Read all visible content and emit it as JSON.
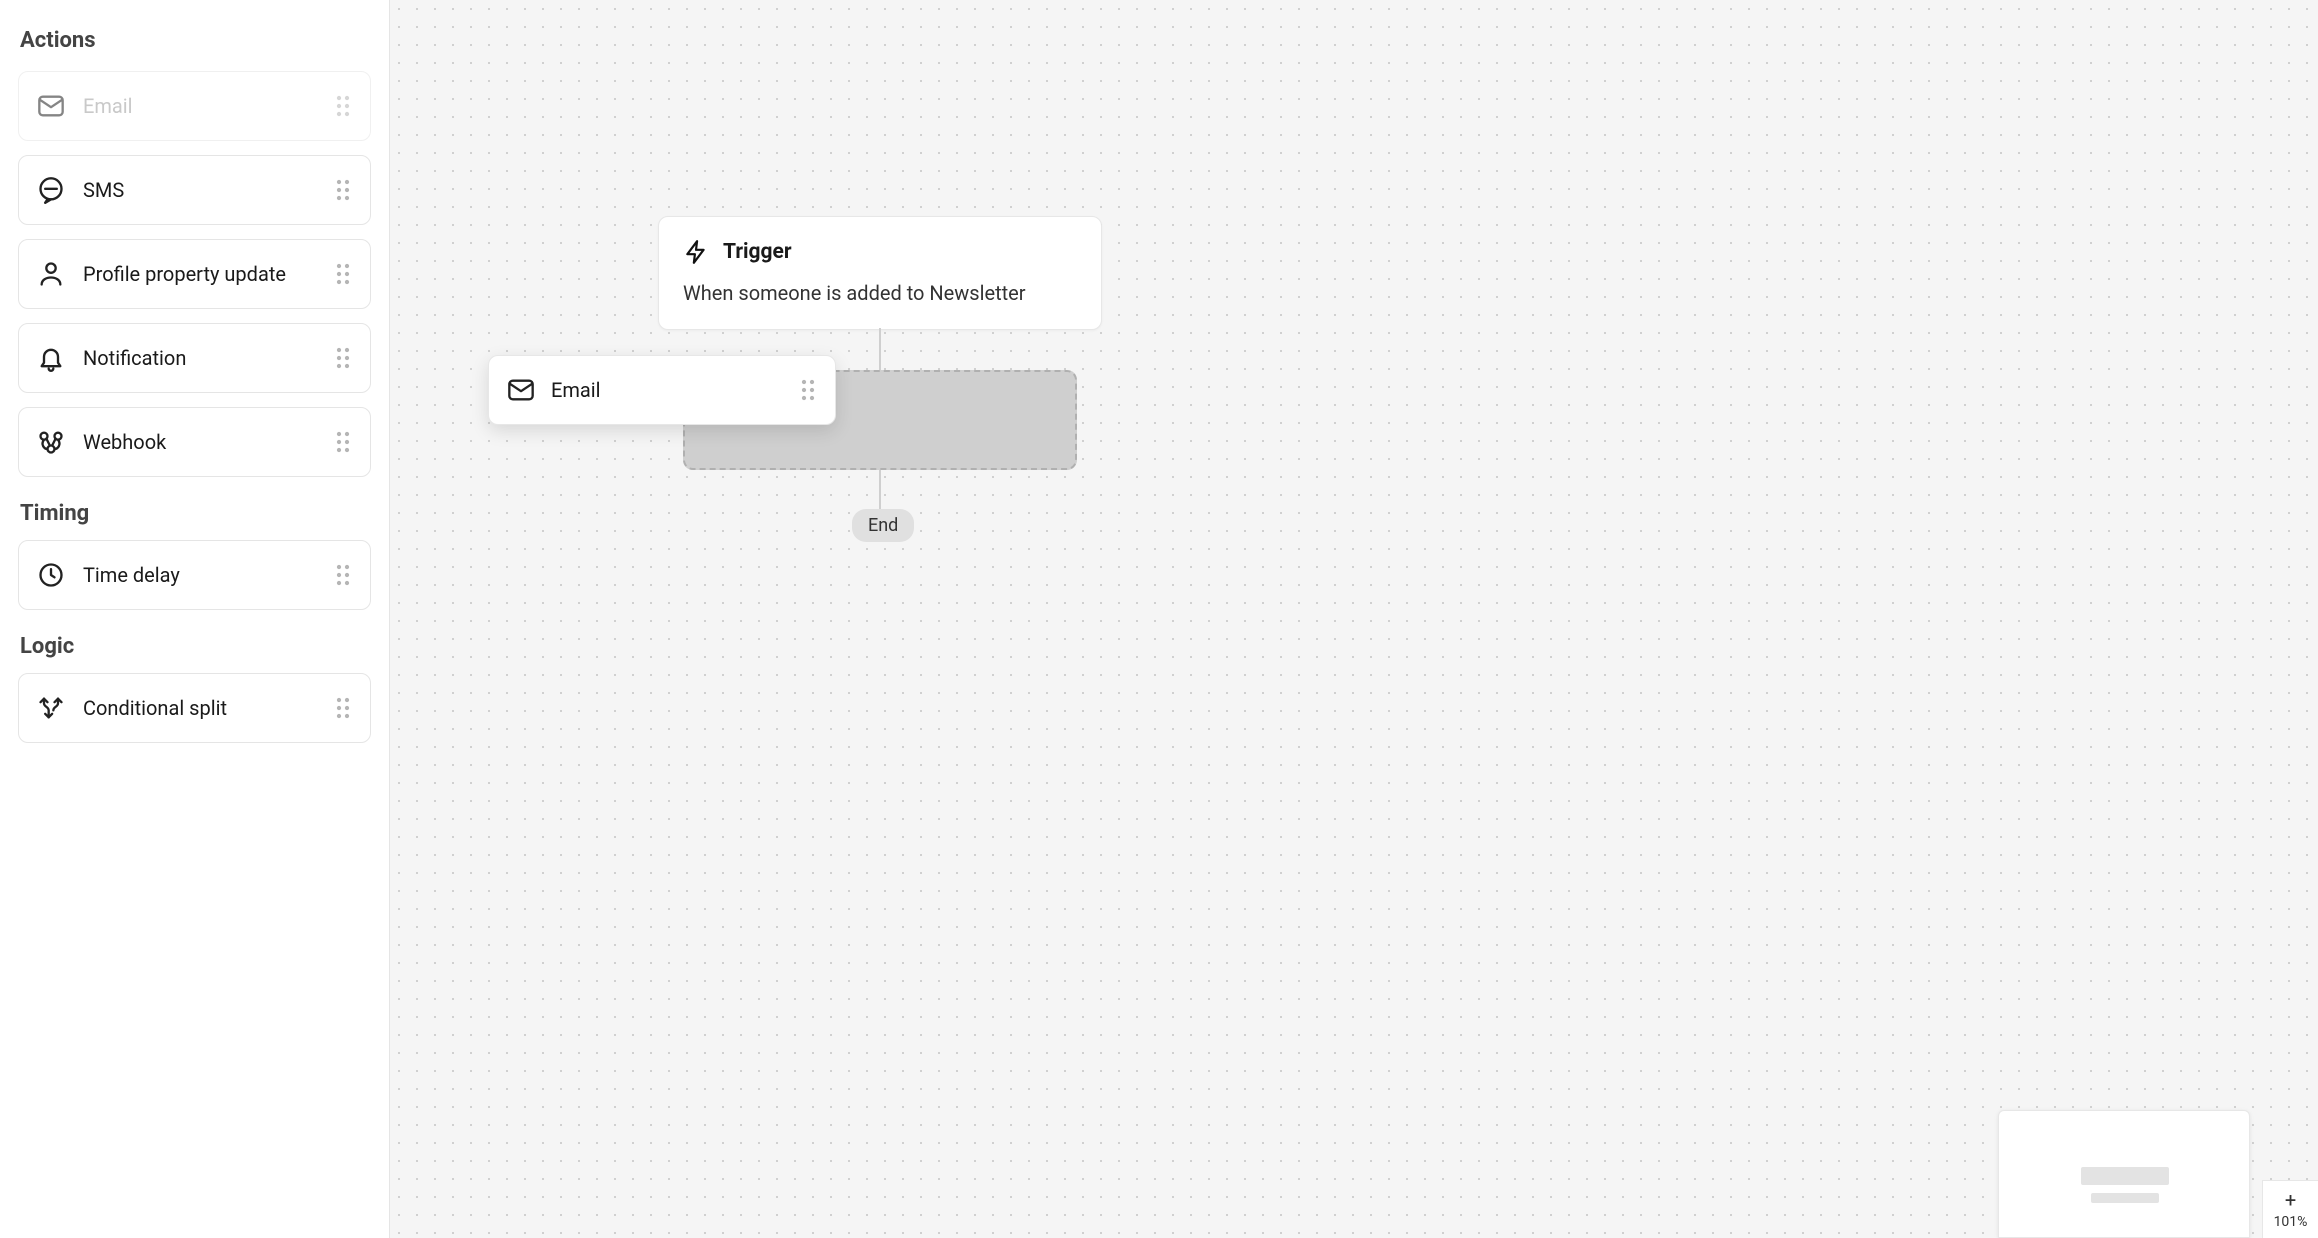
{
  "sidebar": {
    "sections": {
      "actions": {
        "title": "Actions",
        "items": [
          {
            "id": "email",
            "label": "Email",
            "icon": "mail-icon",
            "ghost": true
          },
          {
            "id": "sms",
            "label": "SMS",
            "icon": "sms-icon"
          },
          {
            "id": "profile",
            "label": "Profile property update",
            "icon": "person-icon"
          },
          {
            "id": "notification",
            "label": "Notification",
            "icon": "bell-icon"
          },
          {
            "id": "webhook",
            "label": "Webhook",
            "icon": "webhook-icon"
          }
        ]
      },
      "timing": {
        "title": "Timing",
        "items": [
          {
            "id": "timedelay",
            "label": "Time delay",
            "icon": "clock-icon"
          }
        ]
      },
      "logic": {
        "title": "Logic",
        "items": [
          {
            "id": "conditional",
            "label": "Conditional split",
            "icon": "split-icon"
          }
        ]
      }
    }
  },
  "canvas": {
    "trigger": {
      "title": "Trigger",
      "description": "When someone is added to Newsletter"
    },
    "end_label": "End",
    "dragging_block": {
      "label": "Email"
    },
    "zoom": "101%"
  }
}
